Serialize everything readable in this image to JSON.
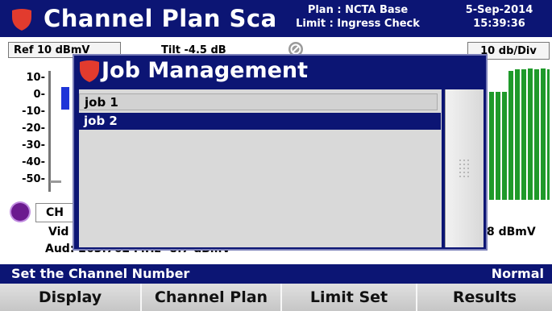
{
  "header": {
    "title": "Channel Plan Sca",
    "plan_line1": "Plan : NCTA Base",
    "plan_line2": "Limit : Ingress Check",
    "date": "5-Sep-2014",
    "time": "15:39:36"
  },
  "plot": {
    "ref_label": "Ref 10 dBmV",
    "tilt_label": "Tilt -4.5 dB",
    "scale_label": "10 db/Div",
    "y_labels": [
      "10-",
      "0-",
      "-10-",
      "-20-",
      "-30-",
      "-40-",
      "-50-"
    ]
  },
  "info": {
    "channel_label": "CH",
    "video_label": "Vid",
    "audio_text": "Aud: 263.762 MHz   -8.7 dBmV",
    "right_level": "8 dBmV"
  },
  "status": {
    "left": "Set the Channel Number",
    "right": "Normal"
  },
  "softkeys": [
    "Display",
    "Channel Plan",
    "Limit Set",
    "Results"
  ],
  "dialog": {
    "title": "Job Management",
    "items": [
      "job  1",
      "job 2"
    ],
    "selected_index": 1
  },
  "colors": {
    "brand_blue": "#0c1574",
    "shield_red": "#e23b2e",
    "bar_green": "#1f9a2a",
    "marker_purple": "#6b1a8f"
  }
}
